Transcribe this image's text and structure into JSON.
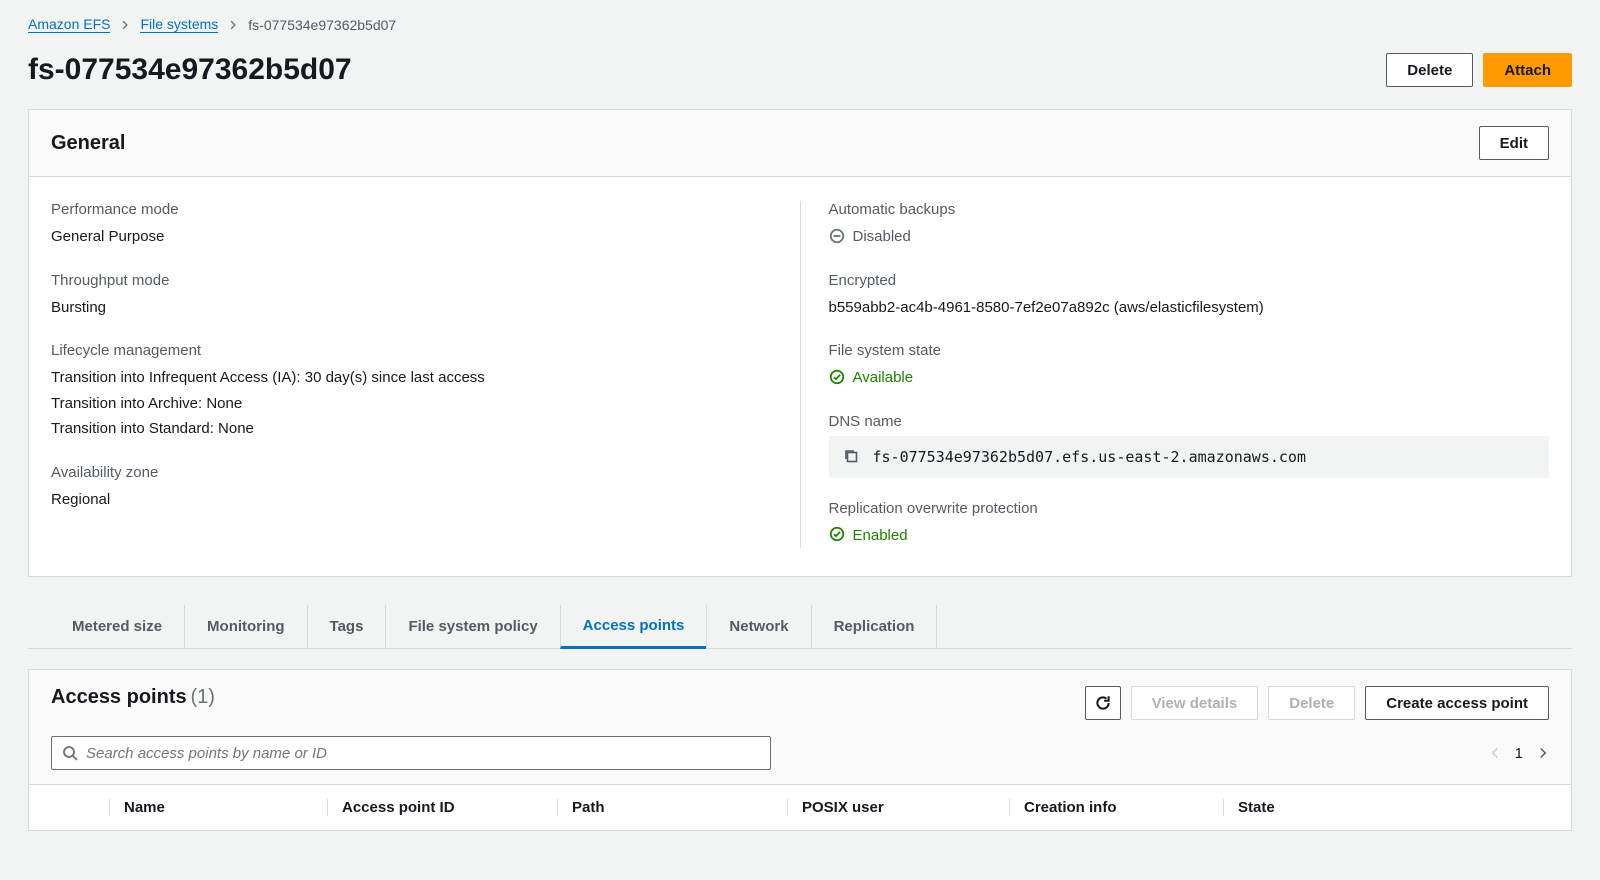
{
  "breadcrumb": {
    "service": "Amazon EFS",
    "parent": "File systems",
    "current": "fs-077534e97362b5d07"
  },
  "header": {
    "title": "fs-077534e97362b5d07",
    "delete": "Delete",
    "attach": "Attach"
  },
  "general": {
    "title": "General",
    "edit": "Edit",
    "performance_mode": {
      "label": "Performance mode",
      "value": "General Purpose"
    },
    "throughput_mode": {
      "label": "Throughput mode",
      "value": "Bursting"
    },
    "lifecycle": {
      "label": "Lifecycle management",
      "ia": "Transition into Infrequent Access (IA): 30 day(s) since last access",
      "archive": "Transition into Archive: None",
      "standard": "Transition into Standard: None"
    },
    "az": {
      "label": "Availability zone",
      "value": "Regional"
    },
    "backups": {
      "label": "Automatic backups",
      "value": "Disabled"
    },
    "encrypted": {
      "label": "Encrypted",
      "value": "b559abb2-ac4b-4961-8580-7ef2e07a892c (aws/elasticfilesystem)"
    },
    "state": {
      "label": "File system state",
      "value": "Available"
    },
    "dns": {
      "label": "DNS name",
      "value": "fs-077534e97362b5d07.efs.us-east-2.amazonaws.com"
    },
    "rop": {
      "label": "Replication overwrite protection",
      "value": "Enabled"
    }
  },
  "tabs": {
    "metered": "Metered size",
    "monitoring": "Monitoring",
    "tags": "Tags",
    "policy": "File system policy",
    "access_points": "Access points",
    "network": "Network",
    "replication": "Replication"
  },
  "access_points": {
    "title": "Access points",
    "count": "(1)",
    "view_details": "View details",
    "delete": "Delete",
    "create": "Create access point",
    "search_placeholder": "Search access points by name or ID",
    "page": "1",
    "columns": {
      "name": "Name",
      "apid": "Access point ID",
      "path": "Path",
      "posix": "POSIX user",
      "cinfo": "Creation info",
      "state": "State"
    }
  }
}
